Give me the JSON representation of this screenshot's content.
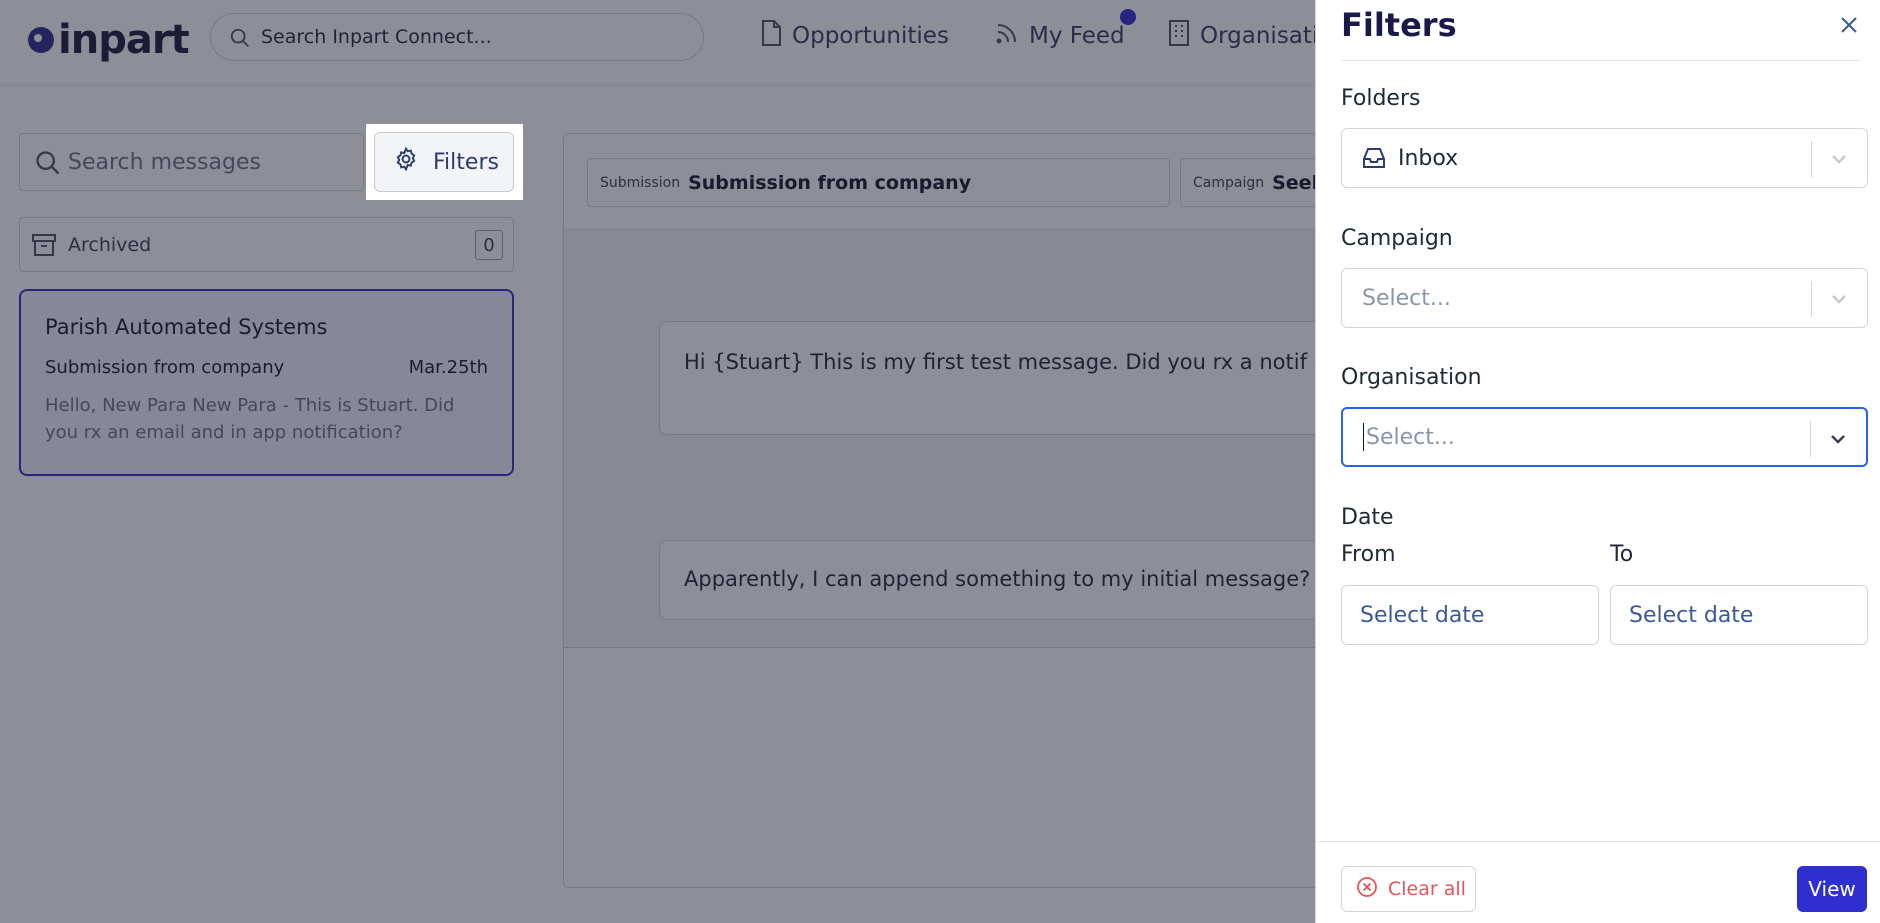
{
  "header": {
    "logo_text": "inpart",
    "search_placeholder": "Search Inpart Connect...",
    "nav": {
      "opportunities": "Opportunities",
      "my_feed": "My Feed",
      "organisations": "Organisati"
    }
  },
  "sidebar": {
    "search_placeholder": "Search messages",
    "filters_label": "Filters",
    "archived_label": "Archived",
    "archived_count": "0",
    "conversation": {
      "title": "Parish Automated Systems",
      "subject": "Submission from company",
      "date": "Mar.25th",
      "preview": "Hello, New Para New Para - This is Stuart. Did you rx an email and in app notification?"
    }
  },
  "thread": {
    "submission_label": "Submission",
    "submission_value": "Submission from company",
    "campaign_label": "Campaign",
    "campaign_value": "Seek",
    "messages": [
      "Hi {Stuart} This is my first test message. Did you rx a notif an MC?",
      "Apparently, I can append something to my initial message? "
    ]
  },
  "drawer": {
    "title": "Filters",
    "folders_label": "Folders",
    "folders_value": "Inbox",
    "campaign_label": "Campaign",
    "campaign_placeholder": "Select...",
    "organisation_label": "Organisation",
    "organisation_placeholder": "Select...",
    "date_label": "Date",
    "from_label": "From",
    "to_label": "To",
    "from_placeholder": "Select date",
    "to_placeholder": "Select date",
    "clear_label": "Clear all",
    "view_label": "View"
  },
  "colors": {
    "accent": "#2f2fd0",
    "clear": "#e0565b",
    "focus": "#2563eb"
  }
}
